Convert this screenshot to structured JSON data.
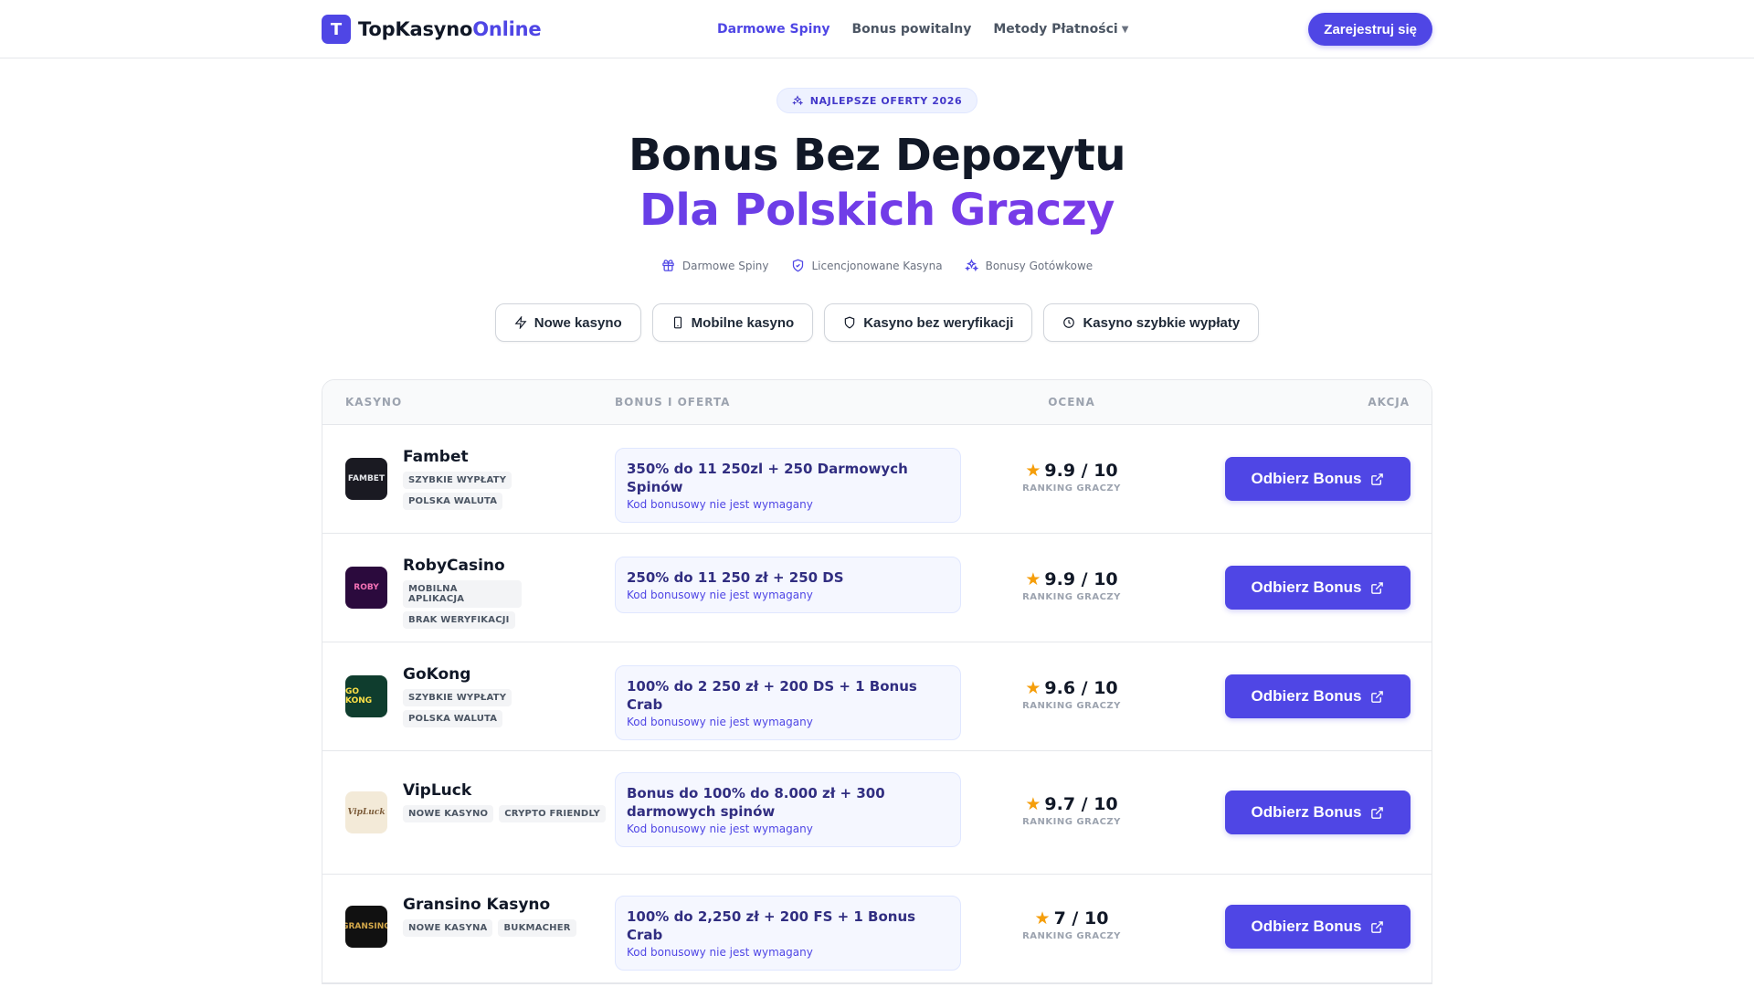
{
  "nav": {
    "brand_letter": "T",
    "brand_main": "TopKasyno",
    "brand_accent": "Online",
    "links": [
      {
        "label": "Darmowe Spiny"
      },
      {
        "label": "Bonus powitalny"
      },
      {
        "label": "Metody Płatności"
      }
    ],
    "register_label": "Zarejestruj się"
  },
  "hero": {
    "badge": "NAJLEPSZE OFERTY 2026",
    "title": "Bonus Bez Depozytu",
    "subtitle": "Dla Polskich Graczy",
    "features": [
      "Darmowe Spiny",
      "Licencjonowane Kasyna",
      "Bonusy Gotówkowe"
    ]
  },
  "filters": [
    "Nowe kasyno",
    "Mobilne kasyno",
    "Kasyno bez weryfikacji",
    "Kasyno szybkie wypłaty"
  ],
  "table": {
    "headers": {
      "casino": "KASYNO",
      "bonus": "BONUS I OFERTA",
      "rating": "OCENA",
      "action": "AKCJA"
    },
    "rows": [
      {
        "name": "Fambet",
        "logo_text": "FAMBET",
        "tags": [
          "SZYBKIE WYPŁATY",
          "POLSKA WALUTA"
        ],
        "offer": "350% do 11 250zl + 250 Darmowych Spinów",
        "note": "Kod bonusowy nie jest wymagany",
        "score": "9.9 / 10",
        "rank_label": "RANKING GRACZY",
        "cta": "Odbierz Bonus"
      },
      {
        "name": "RobyCasino",
        "logo_text": "ROBY",
        "tags": [
          "MOBILNA APLIKACJA",
          "BRAK WERYFIKACJI"
        ],
        "offer": "250% do 11 250 zł + 250 DS",
        "note": "Kod bonusowy nie jest wymagany",
        "score": "9.9 / 10",
        "rank_label": "RANKING GRACZY",
        "cta": "Odbierz Bonus"
      },
      {
        "name": "GoKong",
        "logo_text": "GO KONG",
        "tags": [
          "SZYBKIE WYPŁATY",
          "POLSKA WALUTA"
        ],
        "offer": "100% do 2 250 zł + 200 DS + 1 Bonus Crab",
        "note": "Kod bonusowy nie jest wymagany",
        "score": "9.6 / 10",
        "rank_label": "RANKING GRACZY",
        "cta": "Odbierz Bonus"
      },
      {
        "name": "VipLuck",
        "logo_text": "VipLuck",
        "tags": [
          "NOWE KASYNO",
          "CRYPTO FRIENDLY"
        ],
        "offer": "Bonus do 100% do 8.000 zł + 300 darmowych spinów",
        "note": "Kod bonusowy nie jest wymagany",
        "score": "9.7 / 10",
        "rank_label": "RANKING GRACZY",
        "cta": "Odbierz Bonus"
      },
      {
        "name": "Gransino Kasyno",
        "logo_text": "GRANSINO",
        "tags": [
          "NOWE KASYNA",
          "BUKMACHER"
        ],
        "offer": "100% do 2,250 zł + 200 FS + 1 Bonus Crab",
        "note": "Kod bonusowy nie jest wymagany",
        "score": "7 / 10",
        "rank_label": "RANKING GRACZY",
        "cta": "Odbierz Bonus"
      }
    ]
  },
  "colors": {
    "accent": "#4f46e5",
    "gradient_end": "#9333ea",
    "star": "#f59e0b"
  },
  "icons": {
    "badge": "sparkles-icon",
    "features": [
      "gift-icon",
      "shield-check-icon",
      "sparkles-icon"
    ],
    "filters": [
      "zap-icon",
      "smartphone-icon",
      "shield-icon",
      "clock-icon"
    ],
    "cta": "external-link-icon",
    "rating": "star-icon"
  }
}
